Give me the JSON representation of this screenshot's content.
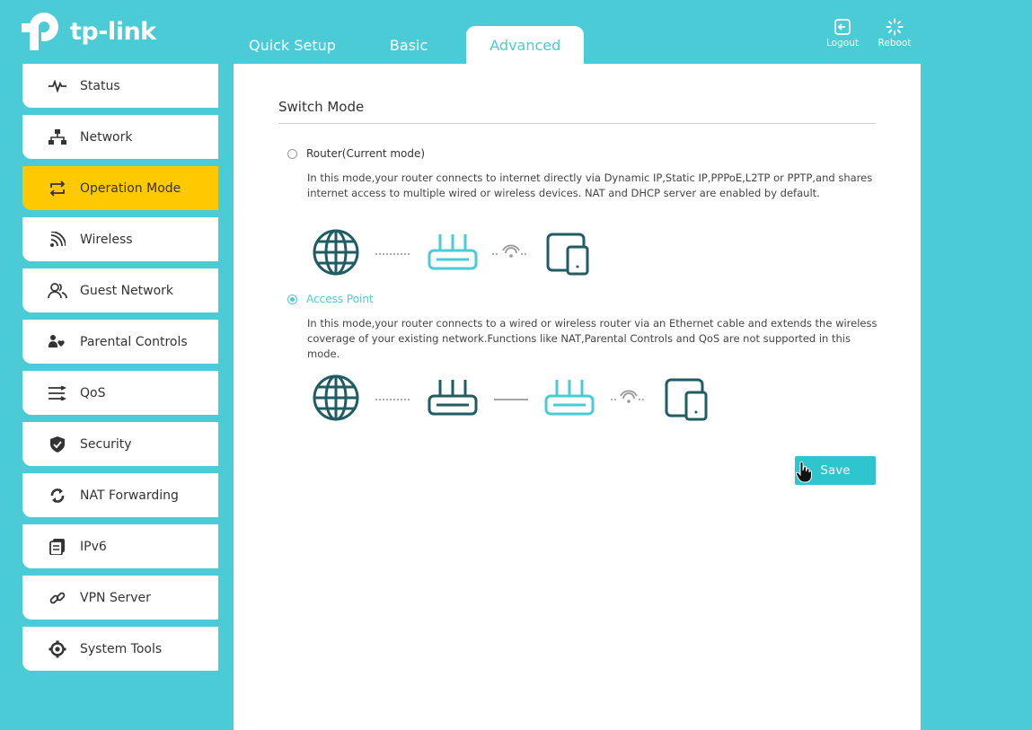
{
  "brand": {
    "name": "tp-link"
  },
  "header": {
    "tabs": [
      {
        "label": "Quick Setup"
      },
      {
        "label": "Basic"
      },
      {
        "label": "Advanced",
        "active": true
      }
    ],
    "logout_label": "Logout",
    "reboot_label": "Reboot"
  },
  "sidebar": {
    "items": [
      {
        "label": "Status",
        "icon": "pulse-icon"
      },
      {
        "label": "Network",
        "icon": "network-icon"
      },
      {
        "label": "Operation Mode",
        "icon": "operation-mode-icon",
        "active": true
      },
      {
        "label": "Wireless",
        "icon": "wireless-icon"
      },
      {
        "label": "Guest Network",
        "icon": "guest-icon"
      },
      {
        "label": "Parental Controls",
        "icon": "parental-icon"
      },
      {
        "label": "QoS",
        "icon": "qos-icon"
      },
      {
        "label": "Security",
        "icon": "shield-icon"
      },
      {
        "label": "NAT Forwarding",
        "icon": "nat-icon"
      },
      {
        "label": "IPv6",
        "icon": "ipv6-icon"
      },
      {
        "label": "VPN Server",
        "icon": "link-icon"
      },
      {
        "label": "System Tools",
        "icon": "gear-icon"
      }
    ]
  },
  "main": {
    "section_title": "Switch Mode",
    "modes": [
      {
        "label": "Router(Current mode)",
        "selected": false,
        "description": "In this mode,your router connects to internet directly via Dynamic IP,Static IP,PPPoE,L2TP or PPTP,and shares internet access to multiple wired or wireless devices. NAT and DHCP server are enabled by default."
      },
      {
        "label": "Access Point",
        "selected": true,
        "description": "In this mode,your router connects to a wired or wireless router via an Ethernet cable and extends the wireless coverage of your existing network.Functions like NAT,Parental Controls and QoS are not supported in this mode."
      }
    ],
    "save_label": "Save"
  },
  "colors": {
    "accent": "#4acbd6",
    "active_nav": "#ffc900",
    "dark_icon": "#1f5c63",
    "save_button": "#2ec5cf"
  }
}
